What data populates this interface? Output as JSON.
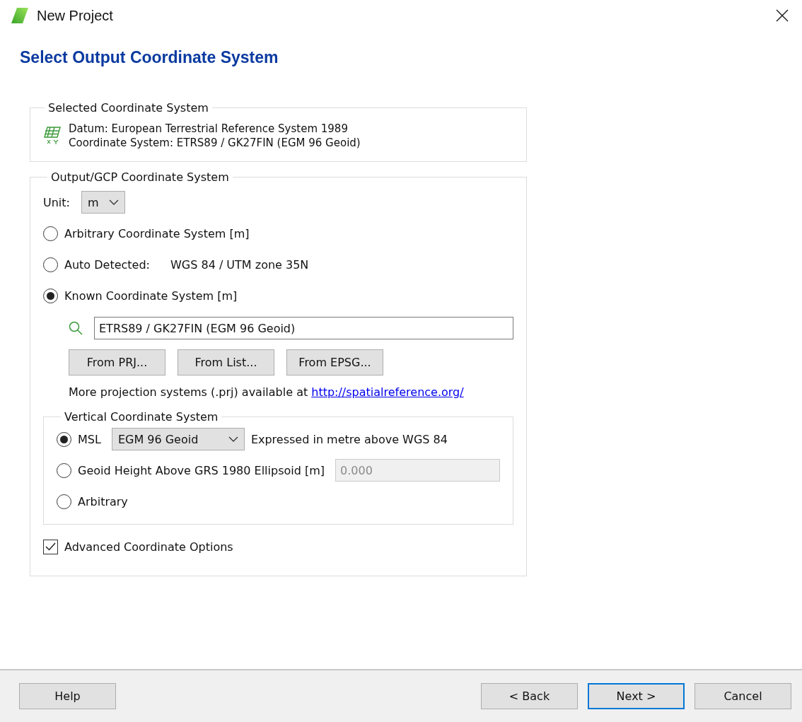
{
  "window": {
    "title": "New Project"
  },
  "heading": "Select Output Coordinate System",
  "selected_system": {
    "title": "Selected Coordinate System",
    "lines": [
      "Datum: European Terrestrial Reference System 1989",
      "Coordinate System: ETRS89 / GK27FIN (EGM 96 Geoid)"
    ]
  },
  "output_system": {
    "title": "Output/GCP Coordinate System",
    "unit": {
      "label": "Unit:",
      "value": "m"
    },
    "options": [
      {
        "label": "Arbitrary Coordinate System [m]",
        "selected": false
      },
      {
        "label": "Auto Detected:",
        "detail": "WGS 84 / UTM zone 35N",
        "selected": false
      },
      {
        "label": "Known Coordinate System [m]",
        "selected": true
      }
    ],
    "search_value": "ETRS89 / GK27FIN (EGM 96 Geoid)",
    "buttons": [
      "From PRJ...",
      "From List...",
      "From EPSG..."
    ],
    "note": "More projection systems (.prj) available at",
    "link": "http://spatialreference.org/",
    "vertical": {
      "title": "Vertical Coordinate System",
      "options": [
        {
          "kind": "select",
          "label": "MSL",
          "value": "EGM 96 Geoid",
          "detail": "Expressed in metre above WGS 84",
          "selected": true
        },
        {
          "kind": "input",
          "label": "Geoid Height Above GRS 1980 Ellipsoid [m]",
          "value": "0.000",
          "disabled": true,
          "selected": false
        },
        {
          "kind": "plain",
          "label": "Arbitrary",
          "selected": false
        }
      ]
    },
    "advanced": {
      "label": "Advanced Coordinate Options",
      "checked": true
    }
  },
  "footer": {
    "left_buttons": [
      {
        "label": "Help",
        "default": false
      }
    ],
    "right_buttons": [
      {
        "label": "< Back",
        "default": false
      },
      {
        "label": "Next >",
        "default": true
      },
      {
        "label": "Cancel",
        "default": false
      }
    ]
  }
}
